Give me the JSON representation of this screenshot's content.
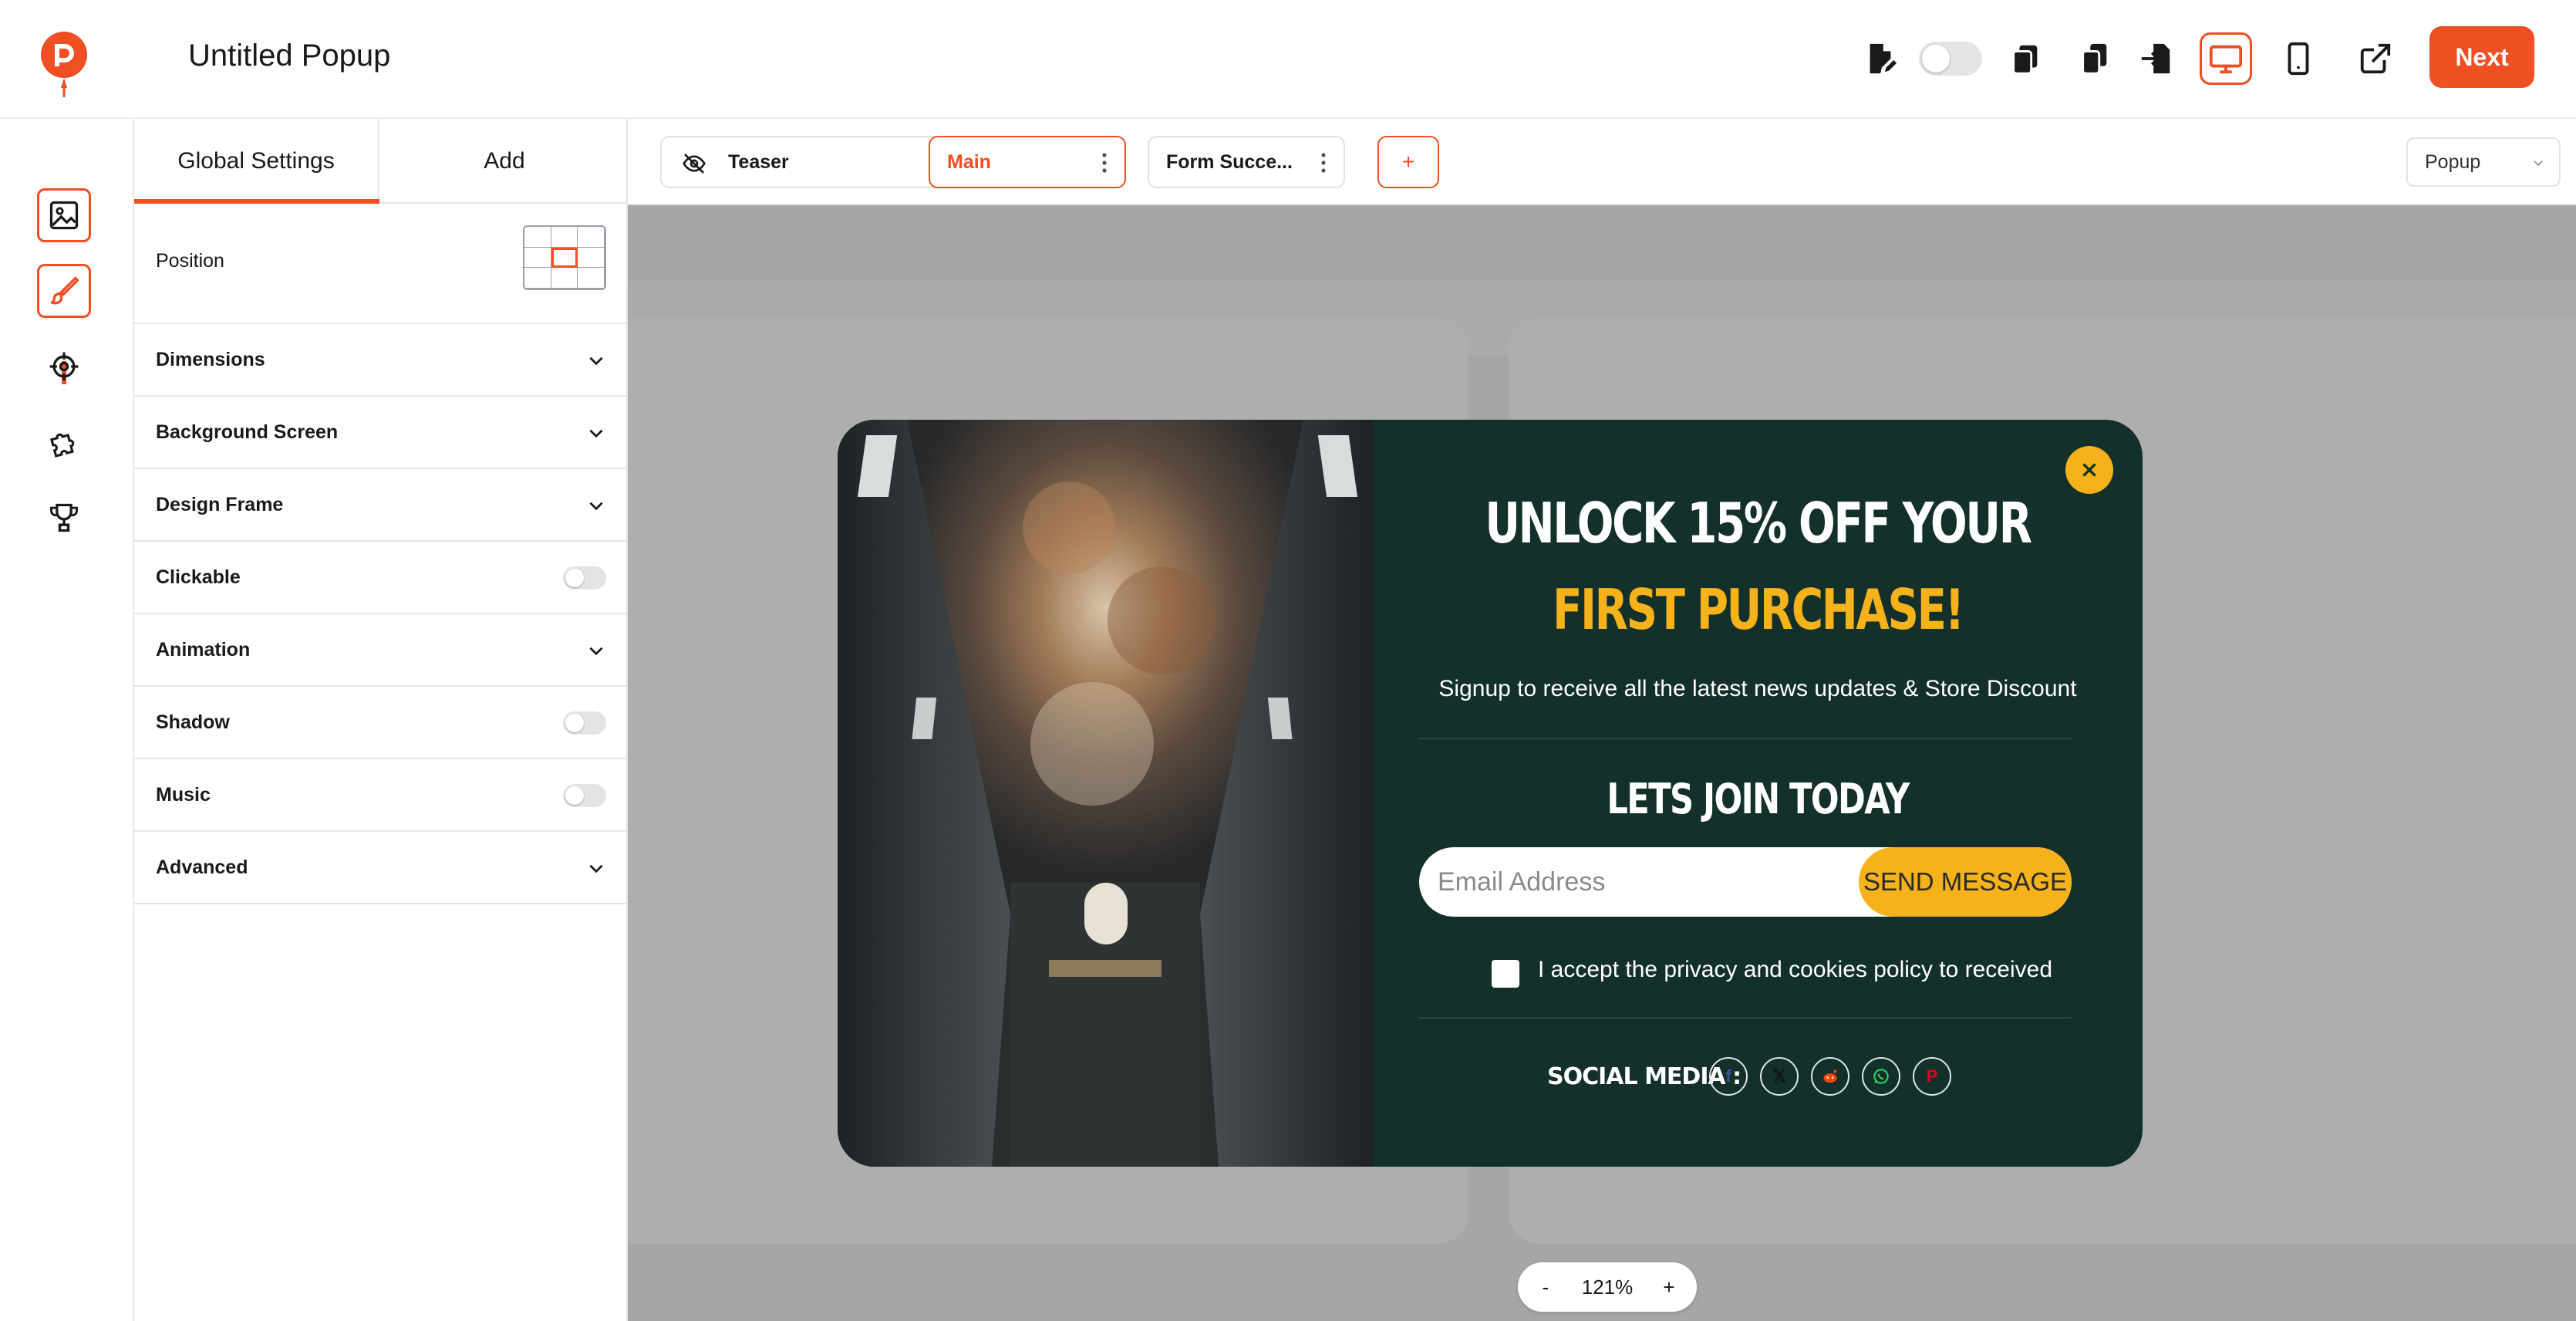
{
  "app": {
    "title": "Untitled Popup"
  },
  "toolbar": {
    "next_label": "Next"
  },
  "panel": {
    "tabs": [
      "Global Settings",
      "Add"
    ],
    "rows": {
      "position": "Position",
      "dimensions": "Dimensions",
      "background_screen": "Background Screen",
      "design_frame": "Design Frame",
      "clickable": "Clickable",
      "animation": "Animation",
      "shadow": "Shadow",
      "music": "Music",
      "advanced": "Advanced"
    }
  },
  "steps": [
    {
      "label": "Teaser"
    },
    {
      "label": "Main"
    },
    {
      "label": "Form Succe..."
    }
  ],
  "add_step_label": "+",
  "popup_type": "Popup",
  "popup": {
    "headline_1": "UNLOCK 15% OFF YOUR",
    "headline_2": "FIRST PURCHASE!",
    "subtitle": "Signup to receive all the latest news updates & Store Discount",
    "join_title": "LETS JOIN TODAY",
    "email_placeholder": "Email Address",
    "send_label": "SEND MESSAGE",
    "consent": "I accept the privacy and cookies policy to received",
    "social_label": "SOCIAL MEDIA :",
    "social_icons": [
      "facebook-icon",
      "x-icon",
      "reddit-icon",
      "whatsapp-icon",
      "pinterest-icon"
    ]
  },
  "zoom": {
    "minus": "-",
    "value": "121%",
    "plus": "+"
  },
  "colors": {
    "accent": "#f04e23",
    "popup_bg": "#13302a",
    "popup_yellow": "#f5b21a",
    "canvas": "#a6a6a6"
  }
}
